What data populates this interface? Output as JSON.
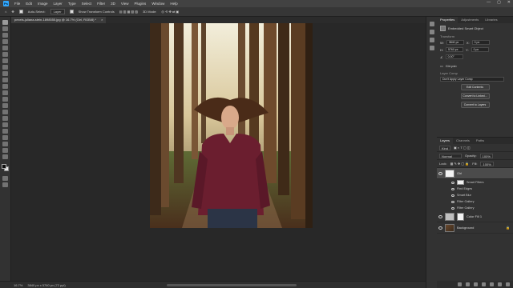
{
  "menu": {
    "logo": "Ps",
    "items": [
      "File",
      "Edit",
      "Image",
      "Layer",
      "Type",
      "Select",
      "Filter",
      "3D",
      "View",
      "Plugins",
      "Window",
      "Help"
    ],
    "win_controls": [
      "—",
      "▢",
      "✕"
    ]
  },
  "options": {
    "auto_select": "Auto-Select:",
    "auto_select_value": "Layer",
    "transform_controls": "Show Transform Controls",
    "mode_3d": "3D Mode:"
  },
  "document": {
    "tab_title": "pexels-juliana-stein-1898555.jpg @ 16.7% (Girl, RGB/8) *",
    "close": "×"
  },
  "status": {
    "zoom": "16.7%",
    "doc_info": "3840 px x 5760 px (72 ppi)"
  },
  "properties": {
    "tabs": [
      "Properties",
      "Adjustments",
      "Libraries"
    ],
    "kind": "Embedded Smart Object",
    "transform_label": "Transform",
    "w_label": "W:",
    "w_value": "3840 px",
    "h_label": "H:",
    "h_value": "5760 px",
    "x_label": "X:",
    "x_value": "0 px",
    "y_label": "Y:",
    "y_value": "0 px",
    "angle_value": "0.00°",
    "file_label": "Girl.psb",
    "layer_comp_label": "Layer Comp",
    "layer_comp_placeholder": "Don't Apply Layer Comp",
    "btn_edit": "Edit Contents",
    "btn_linked": "Convert to Linked...",
    "btn_layers": "Convert to Layers"
  },
  "layers": {
    "tabs": [
      "Layers",
      "Channels",
      "Paths"
    ],
    "kind_label": "Kind",
    "blend": "Normal",
    "opacity_label": "Opacity:",
    "opacity": "100%",
    "lock_label": "Lock:",
    "fill_label": "Fill:",
    "fill": "100%",
    "items": [
      {
        "name": "Girl",
        "selected": true
      },
      {
        "name": "Color Fill 1",
        "selected": false
      },
      {
        "name": "Background",
        "selected": false
      }
    ],
    "smart_filters_label": "Smart Filters",
    "filters": [
      "Find Edges",
      "Smart Blur",
      "Filter Gallery",
      "Filter Gallery"
    ]
  }
}
